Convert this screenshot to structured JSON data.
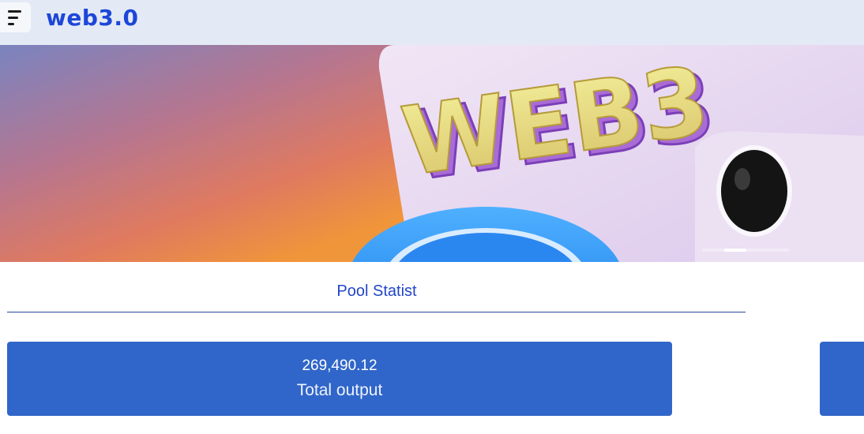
{
  "header": {
    "logo_text": "web3.0",
    "menu_icon": "hamburger-menu-icon"
  },
  "banner": {
    "art_text": "WEB3",
    "carousel_total": 4,
    "carousel_active": 2
  },
  "pool": {
    "title": "Pool Statist",
    "stats": [
      {
        "value": "269,490.12",
        "label": "Total output"
      }
    ]
  },
  "colors": {
    "header_bg": "#e3eaf5",
    "brand": "#1d46d8",
    "card": "#3066c9"
  }
}
